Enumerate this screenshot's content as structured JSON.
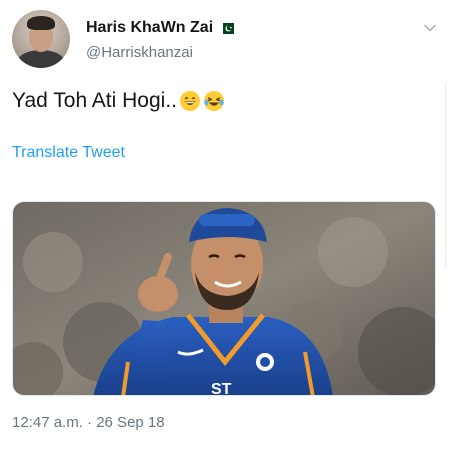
{
  "tweet": {
    "author_name": "Haris KhaWn Zai",
    "author_handle": "@Harriskhanzai",
    "text": "Yad Toh Ati Hogi..",
    "emojis": [
      "grinning-face-icon",
      "rolling-on-floor-laughing-icon"
    ],
    "translate_label": "Translate Tweet",
    "timestamp": "12:47 a.m. · 26 Sep 18",
    "jersey_text": "ST"
  },
  "colors": {
    "link": "#1da1f2",
    "secondary_text": "#657786",
    "primary_text": "#14171a",
    "jersey_blue": "#1f4fa8",
    "flag_green": "#01411c"
  },
  "icons": {
    "flag": "pakistan-flag-icon",
    "menu": "chevron-down-icon"
  }
}
